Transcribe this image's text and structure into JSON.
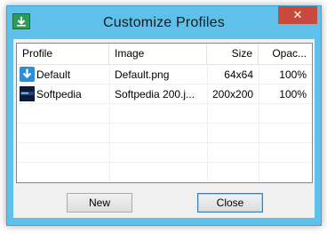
{
  "window": {
    "title": "Customize Profiles",
    "close_glyph": "✕"
  },
  "list": {
    "columns": [
      "Profile",
      "Image",
      "Size",
      "Opac..."
    ],
    "rows": [
      {
        "profile": "Default",
        "image": "Default.png",
        "size": "64x64",
        "opacity": "100%",
        "icon": "download-arrow-icon"
      },
      {
        "profile": "Softpedia",
        "image": "Softpedia 200.j...",
        "size": "200x200",
        "opacity": "100%",
        "icon": "softpedia-thumbnail-icon"
      }
    ]
  },
  "buttons": {
    "new_label": "New",
    "close_label": "Close"
  },
  "colors": {
    "frame": "#5fc0ea",
    "close_button": "#c74a3d"
  }
}
